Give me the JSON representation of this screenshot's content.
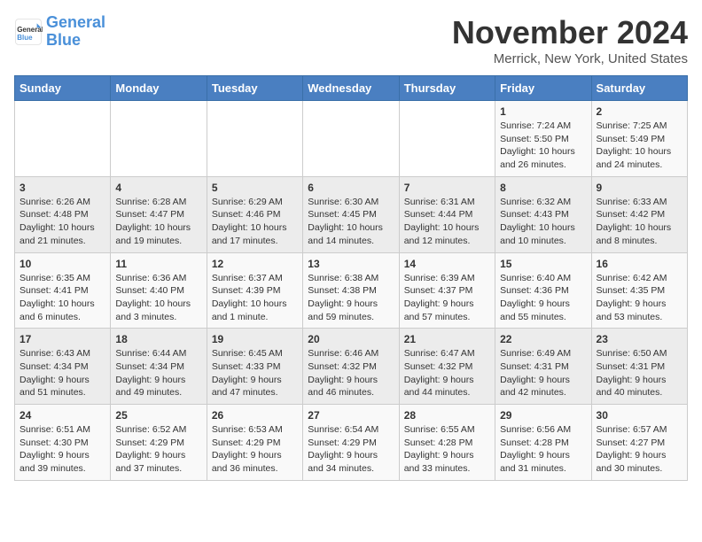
{
  "logo": {
    "text_general": "General",
    "text_blue": "Blue"
  },
  "calendar": {
    "title": "November 2024",
    "subtitle": "Merrick, New York, United States"
  },
  "weekdays": [
    "Sunday",
    "Monday",
    "Tuesday",
    "Wednesday",
    "Thursday",
    "Friday",
    "Saturday"
  ],
  "weeks": [
    [
      {
        "day": "",
        "info": ""
      },
      {
        "day": "",
        "info": ""
      },
      {
        "day": "",
        "info": ""
      },
      {
        "day": "",
        "info": ""
      },
      {
        "day": "",
        "info": ""
      },
      {
        "day": "1",
        "info": "Sunrise: 7:24 AM\nSunset: 5:50 PM\nDaylight: 10 hours and 26 minutes."
      },
      {
        "day": "2",
        "info": "Sunrise: 7:25 AM\nSunset: 5:49 PM\nDaylight: 10 hours and 24 minutes."
      }
    ],
    [
      {
        "day": "3",
        "info": "Sunrise: 6:26 AM\nSunset: 4:48 PM\nDaylight: 10 hours and 21 minutes."
      },
      {
        "day": "4",
        "info": "Sunrise: 6:28 AM\nSunset: 4:47 PM\nDaylight: 10 hours and 19 minutes."
      },
      {
        "day": "5",
        "info": "Sunrise: 6:29 AM\nSunset: 4:46 PM\nDaylight: 10 hours and 17 minutes."
      },
      {
        "day": "6",
        "info": "Sunrise: 6:30 AM\nSunset: 4:45 PM\nDaylight: 10 hours and 14 minutes."
      },
      {
        "day": "7",
        "info": "Sunrise: 6:31 AM\nSunset: 4:44 PM\nDaylight: 10 hours and 12 minutes."
      },
      {
        "day": "8",
        "info": "Sunrise: 6:32 AM\nSunset: 4:43 PM\nDaylight: 10 hours and 10 minutes."
      },
      {
        "day": "9",
        "info": "Sunrise: 6:33 AM\nSunset: 4:42 PM\nDaylight: 10 hours and 8 minutes."
      }
    ],
    [
      {
        "day": "10",
        "info": "Sunrise: 6:35 AM\nSunset: 4:41 PM\nDaylight: 10 hours and 6 minutes."
      },
      {
        "day": "11",
        "info": "Sunrise: 6:36 AM\nSunset: 4:40 PM\nDaylight: 10 hours and 3 minutes."
      },
      {
        "day": "12",
        "info": "Sunrise: 6:37 AM\nSunset: 4:39 PM\nDaylight: 10 hours and 1 minute."
      },
      {
        "day": "13",
        "info": "Sunrise: 6:38 AM\nSunset: 4:38 PM\nDaylight: 9 hours and 59 minutes."
      },
      {
        "day": "14",
        "info": "Sunrise: 6:39 AM\nSunset: 4:37 PM\nDaylight: 9 hours and 57 minutes."
      },
      {
        "day": "15",
        "info": "Sunrise: 6:40 AM\nSunset: 4:36 PM\nDaylight: 9 hours and 55 minutes."
      },
      {
        "day": "16",
        "info": "Sunrise: 6:42 AM\nSunset: 4:35 PM\nDaylight: 9 hours and 53 minutes."
      }
    ],
    [
      {
        "day": "17",
        "info": "Sunrise: 6:43 AM\nSunset: 4:34 PM\nDaylight: 9 hours and 51 minutes."
      },
      {
        "day": "18",
        "info": "Sunrise: 6:44 AM\nSunset: 4:34 PM\nDaylight: 9 hours and 49 minutes."
      },
      {
        "day": "19",
        "info": "Sunrise: 6:45 AM\nSunset: 4:33 PM\nDaylight: 9 hours and 47 minutes."
      },
      {
        "day": "20",
        "info": "Sunrise: 6:46 AM\nSunset: 4:32 PM\nDaylight: 9 hours and 46 minutes."
      },
      {
        "day": "21",
        "info": "Sunrise: 6:47 AM\nSunset: 4:32 PM\nDaylight: 9 hours and 44 minutes."
      },
      {
        "day": "22",
        "info": "Sunrise: 6:49 AM\nSunset: 4:31 PM\nDaylight: 9 hours and 42 minutes."
      },
      {
        "day": "23",
        "info": "Sunrise: 6:50 AM\nSunset: 4:31 PM\nDaylight: 9 hours and 40 minutes."
      }
    ],
    [
      {
        "day": "24",
        "info": "Sunrise: 6:51 AM\nSunset: 4:30 PM\nDaylight: 9 hours and 39 minutes."
      },
      {
        "day": "25",
        "info": "Sunrise: 6:52 AM\nSunset: 4:29 PM\nDaylight: 9 hours and 37 minutes."
      },
      {
        "day": "26",
        "info": "Sunrise: 6:53 AM\nSunset: 4:29 PM\nDaylight: 9 hours and 36 minutes."
      },
      {
        "day": "27",
        "info": "Sunrise: 6:54 AM\nSunset: 4:29 PM\nDaylight: 9 hours and 34 minutes."
      },
      {
        "day": "28",
        "info": "Sunrise: 6:55 AM\nSunset: 4:28 PM\nDaylight: 9 hours and 33 minutes."
      },
      {
        "day": "29",
        "info": "Sunrise: 6:56 AM\nSunset: 4:28 PM\nDaylight: 9 hours and 31 minutes."
      },
      {
        "day": "30",
        "info": "Sunrise: 6:57 AM\nSunset: 4:27 PM\nDaylight: 9 hours and 30 minutes."
      }
    ]
  ]
}
